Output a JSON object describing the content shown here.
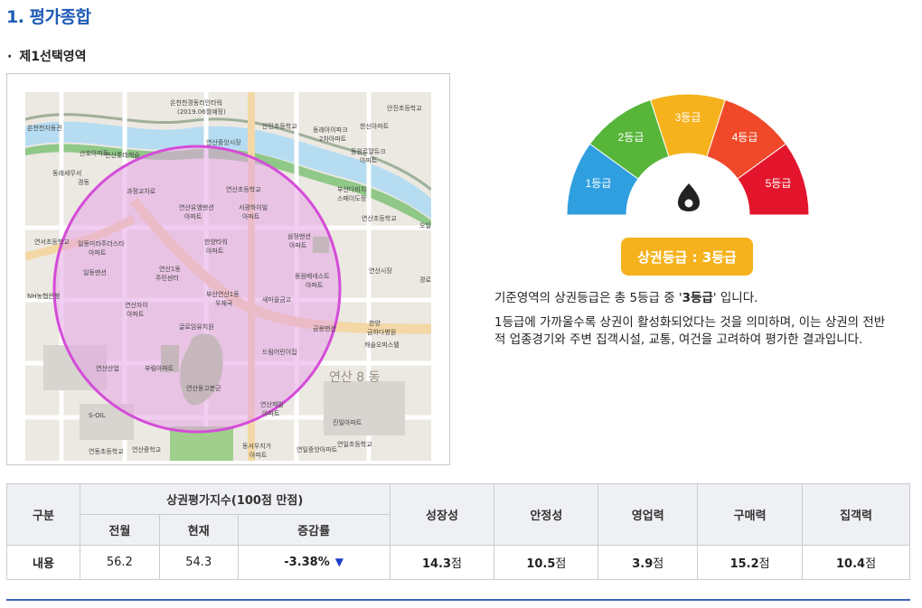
{
  "header": {
    "title": "1. 평가종합",
    "section_bullet": "·",
    "section": "제1선택영역"
  },
  "map": {
    "labels": [
      "온천천경동리인타워 (2019.06월예정)",
      "안민초등학교",
      "안진초등학교",
      "온천천자동관 (1단지아파트)",
      "동래아이파크 2차아파트",
      "한신아파트",
      "산호아파트",
      "연산롯데캐슬아파트",
      "연산중앙시장",
      "동원로얄듀크 아파트",
      "동래세무서",
      "경동",
      "과정 교차로",
      "연산초등학교",
      "연산유엠맨션 아파트",
      "서광하이빌 아파트",
      "한양타워 아파트",
      "삼정맨션 아파트",
      "연산초등학교",
      "일동미라주더스타 아파트",
      "연산1동 주민센터",
      "부산연산1동 우체국",
      "동원베네스트 아파트",
      "연산시장",
      "NH농협은행",
      "연산자이 아파트",
      "새마을금고",
      "금용맨션",
      "한양 금하다병원",
      "캐슬오피스텔",
      "글로임유치원",
      "드림어린이집",
      "부림아파트",
      "연산동고분군",
      "연산산업",
      "S-OIL",
      "연산8동",
      "연산제일아파트",
      "진일아파트",
      "연일초등학교",
      "연동초등학교",
      "연산중학교",
      "동서우지가 아파트",
      "연일중앙아파트",
      "부산다비치 스페이도정",
      "오일",
      "경로"
    ]
  },
  "gauge": {
    "grades": [
      "1등급",
      "2등급",
      "3등급",
      "4등급",
      "5등급"
    ],
    "colors": [
      "#2f9fe0",
      "#57b53a",
      "#f5b21c",
      "#f0492a",
      "#e2152c"
    ],
    "active_grade": 3
  },
  "badge": "상권등급 : 3등급",
  "description": {
    "line1_pre": "기준영역의 상권등급은 총 5등급 중 '",
    "line1_bold": "3등급",
    "line1_post": "' 입니다.",
    "line2": "1등급에 가까울수록 상권이 활성화되었다는 것을 의미하며, 이는 상권의 전반적 업종경기와 주변 집객시설, 교통, 여건을 고려하여 평가한 결과입니다."
  },
  "table": {
    "headers": {
      "category": "구분",
      "index_group": "상권평가지수(100점 만점)",
      "prev": "전월",
      "current": "현재",
      "change": "증감률",
      "growth": "성장성",
      "stability": "안정성",
      "sales": "영업력",
      "purchasing": "구매력",
      "attraction": "집객력"
    },
    "row": {
      "label": "내용",
      "prev": "56.2",
      "current": "54.3",
      "change": "-3.38%",
      "change_arrow": "▼",
      "growth": "14.3",
      "stability": "10.5",
      "sales": "3.9",
      "purchasing": "15.2",
      "attraction": "10.4",
      "unit": "점"
    }
  }
}
